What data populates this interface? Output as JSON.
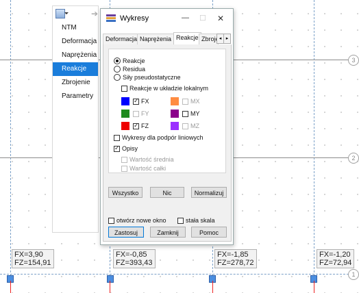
{
  "side_panel": {
    "items": [
      {
        "label": "NTM"
      },
      {
        "label": "Deformacja"
      },
      {
        "label": "Naprężenia"
      },
      {
        "label": "Reakcje"
      },
      {
        "label": "Zbrojenie"
      },
      {
        "label": "Parametry"
      }
    ],
    "selected": "Reakcje"
  },
  "dialog": {
    "title": "Wykresy",
    "tabs": [
      "Deformacja",
      "Naprężenia",
      "Reakcje",
      "Zbroje"
    ],
    "active_tab": "Reakcje",
    "radio": {
      "reakcje": "Reakcje",
      "residua": "Residua",
      "sily": "Siły pseudostatyczne",
      "selected": "Reakcje"
    },
    "local_label": "Reakcje w układzie lokalnym",
    "components": [
      {
        "label": "FX",
        "color": "#0000ff",
        "checked": true,
        "enabled": true
      },
      {
        "label": "MX",
        "color": "#ff8c42",
        "checked": false,
        "enabled": false
      },
      {
        "label": "FY",
        "color": "#1f8a1f",
        "checked": false,
        "enabled": false
      },
      {
        "label": "MY",
        "color": "#8b008b",
        "checked": false,
        "enabled": true
      },
      {
        "label": "FZ",
        "color": "#ee0000",
        "checked": true,
        "enabled": true
      },
      {
        "label": "MZ",
        "color": "#9b30ff",
        "checked": false,
        "enabled": false
      }
    ],
    "wykresy_podpor": "Wykresy dla podpór liniowych",
    "opisy": "Opisy",
    "wartosc_srednia": "Wartość średnia",
    "wartosc_calki": "Wartość całki",
    "buttons": {
      "wszystko": "Wszystko",
      "nic": "Nic",
      "normalizuj": "Normalizuj"
    },
    "otworz_nowe_okno": "otwórz nowe okno",
    "stala_skala": "stała skala",
    "zastosuj": "Zastosuj",
    "zamknij": "Zamknij",
    "pomoc": "Pomoc"
  },
  "canvas": {
    "axes": [
      "3",
      "2",
      "1"
    ],
    "reactions": [
      {
        "fx": "FX=3,90",
        "fz": "FZ=154,91"
      },
      {
        "fx": "FX=-0,85",
        "fz": "FZ=393,43"
      },
      {
        "fx": "FX=-1,85",
        "fz": "FZ=278,72"
      },
      {
        "fx": "FX=-1,20",
        "fz": "FZ=72,94"
      }
    ]
  }
}
